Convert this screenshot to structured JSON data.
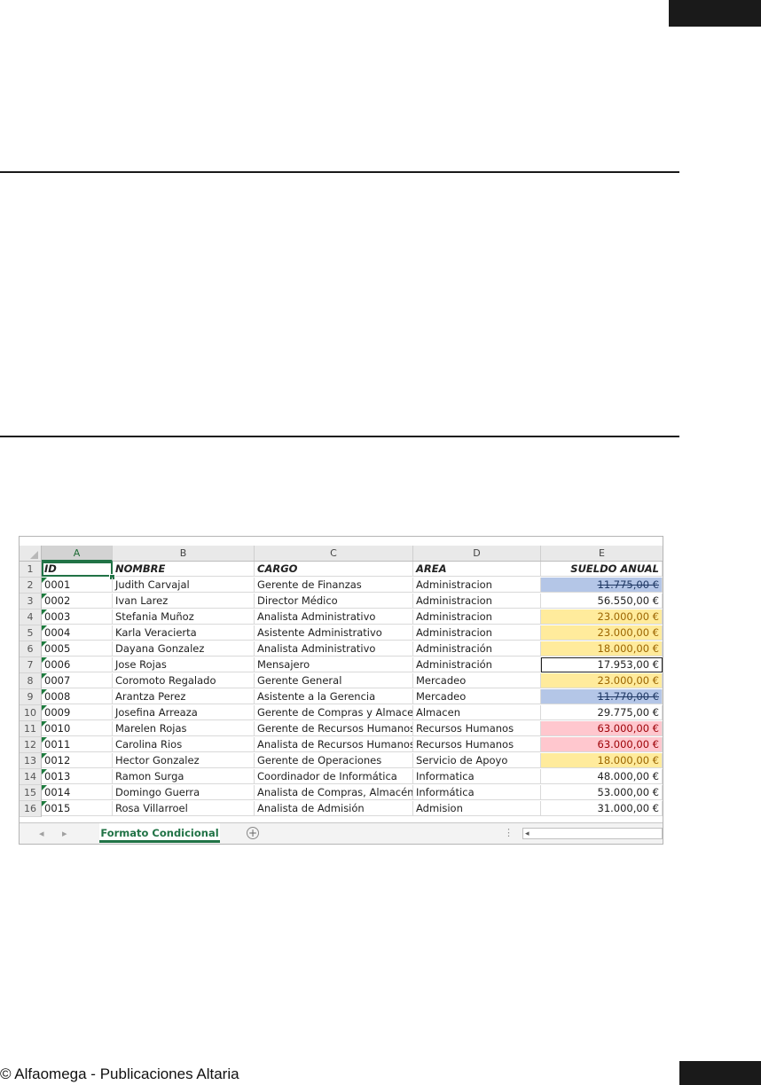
{
  "footer": {
    "text": "© Alfaomega - Publicaciones Altaria"
  },
  "spreadsheet": {
    "columns": [
      "A",
      "B",
      "C",
      "D",
      "E"
    ],
    "header": {
      "row": "1",
      "id": "ID",
      "nombre": "NOMBRE",
      "cargo": "CARGO",
      "area": "AREA",
      "sueldo": "SUELDO ANUAL"
    },
    "rows": [
      {
        "row": "2",
        "id": "0001",
        "nombre": "Judith Carvajal",
        "cargo": "Gerente de Finanzas",
        "area": "Administracion",
        "sueldo": "11.775,00 €",
        "fill": "#b4c6e7",
        "color": "#1f3864",
        "strike": true
      },
      {
        "row": "3",
        "id": "0002",
        "nombre": "Ivan Larez",
        "cargo": "Director Médico",
        "area": "Administracion",
        "sueldo": "56.550,00 €",
        "fill": "",
        "color": "#222222",
        "strike": false
      },
      {
        "row": "4",
        "id": "0003",
        "nombre": "Stefania Muñoz",
        "cargo": "Analista Administrativo",
        "area": "Administracion",
        "sueldo": "23.000,00 €",
        "fill": "#ffeb9c",
        "color": "#9c6500",
        "strike": false
      },
      {
        "row": "5",
        "id": "0004",
        "nombre": "Karla Veracierta",
        "cargo": "Asistente Administrativo",
        "area": "Administracion",
        "sueldo": "23.000,00 €",
        "fill": "#ffeb9c",
        "color": "#9c6500",
        "strike": false
      },
      {
        "row": "6",
        "id": "0005",
        "nombre": "Dayana Gonzalez",
        "cargo": "Analista Administrativo",
        "area": "Administración",
        "sueldo": "18.000,00 €",
        "fill": "#ffeb9c",
        "color": "#9c6500",
        "strike": false
      },
      {
        "row": "7",
        "id": "0006",
        "nombre": "Jose Rojas",
        "cargo": "Mensajero",
        "area": "Administración",
        "sueldo": "17.953,00 €",
        "fill": "",
        "color": "#222222",
        "strike": false,
        "boxed": true
      },
      {
        "row": "8",
        "id": "0007",
        "nombre": "Coromoto Regalado",
        "cargo": "Gerente General",
        "area": "Mercadeo",
        "sueldo": "23.000,00 €",
        "fill": "#ffeb9c",
        "color": "#9c6500",
        "strike": false
      },
      {
        "row": "9",
        "id": "0008",
        "nombre": "Arantza Perez",
        "cargo": "Asistente a la Gerencia",
        "area": "Mercadeo",
        "sueldo": "11.770,00 €",
        "fill": "#b4c6e7",
        "color": "#1f3864",
        "strike": true
      },
      {
        "row": "10",
        "id": "0009",
        "nombre": "Josefina Arreaza",
        "cargo": "Gerente de Compras y Almacen",
        "area": "Almacen",
        "sueldo": "29.775,00 €",
        "fill": "",
        "color": "#222222",
        "strike": false
      },
      {
        "row": "11",
        "id": "0010",
        "nombre": "Marelen Rojas",
        "cargo": "Gerente de Recursos Humanos",
        "area": "Recursos Humanos",
        "sueldo": "63.000,00 €",
        "fill": "#ffc7ce",
        "color": "#9c0006",
        "strike": false
      },
      {
        "row": "12",
        "id": "0011",
        "nombre": "Carolina Rios",
        "cargo": "Analista de Recursos Humanos",
        "area": "Recursos Humanos",
        "sueldo": "63.000,00 €",
        "fill": "#ffc7ce",
        "color": "#9c0006",
        "strike": false
      },
      {
        "row": "13",
        "id": "0012",
        "nombre": "Hector Gonzalez",
        "cargo": "Gerente de Operaciones",
        "area": "Servicio de Apoyo",
        "sueldo": "18.000,00 €",
        "fill": "#ffeb9c",
        "color": "#9c6500",
        "strike": false
      },
      {
        "row": "14",
        "id": "0013",
        "nombre": "Ramon Surga",
        "cargo": "Coordinador de Informática",
        "area": "Informatica",
        "sueldo": "48.000,00 €",
        "fill": "",
        "color": "#222222",
        "strike": false
      },
      {
        "row": "15",
        "id": "0014",
        "nombre": "Domingo Guerra",
        "cargo": "Analista de Compras, Almacén e",
        "area": "Informática",
        "sueldo": "53.000,00 €",
        "fill": "",
        "color": "#222222",
        "strike": false
      },
      {
        "row": "16",
        "id": "0015",
        "nombre": "Rosa Villarroel",
        "cargo": "Analista de Admisión",
        "area": "Admision",
        "sueldo": "31.000,00 €",
        "fill": "",
        "color": "#222222",
        "strike": false
      }
    ],
    "sheet_tab": "Formato Condicional",
    "add_sheet_icon": "+",
    "nav_left": "◂",
    "nav_right": "▸",
    "more_dots": "⋮",
    "scroll_left": "◂"
  }
}
